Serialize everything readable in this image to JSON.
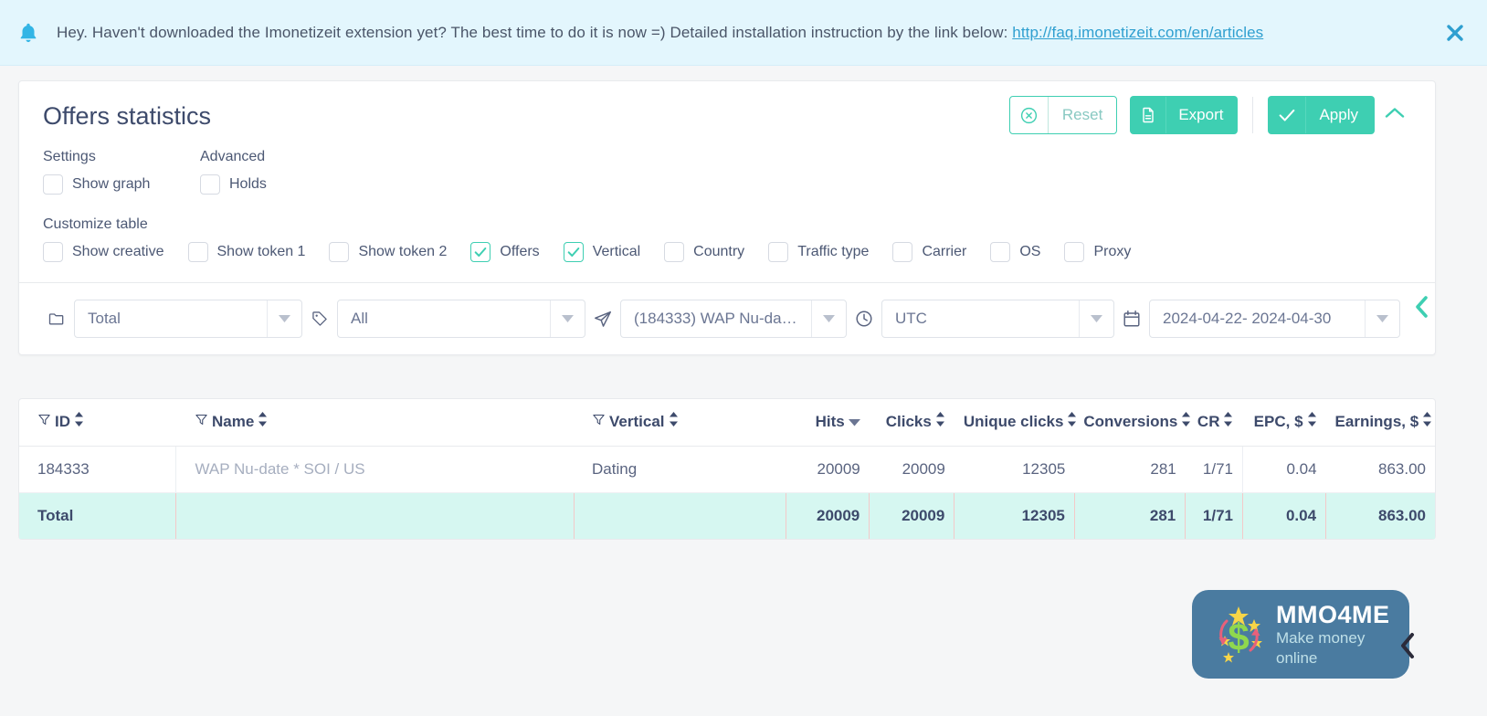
{
  "banner": {
    "icon": "bell-icon",
    "text_before": "Hey. Haven't downloaded the Imonetizeit extension yet? The best time to do it is now =) Detailed installation instruction by the link below: ",
    "link_text": "http://faq.imonetizeit.com/en/articles",
    "close_icon": "close-icon",
    "bg_color": "#e3f6fd"
  },
  "card": {
    "title": "Offers statistics",
    "actions": {
      "reset_label": "Reset",
      "reset_icon": "circle-x-icon",
      "export_label": "Export",
      "export_icon": "document-icon",
      "apply_label": "Apply",
      "apply_icon": "check-icon",
      "collapse_icon": "chevron-up-icon",
      "accent_color": "#3ecfb2"
    },
    "settings": {
      "group_label": "Settings",
      "items": [
        {
          "label": "Show graph",
          "checked": false
        }
      ]
    },
    "advanced": {
      "group_label": "Advanced",
      "items": [
        {
          "label": "Holds",
          "checked": false
        }
      ]
    },
    "customize": {
      "group_label": "Customize table",
      "items": [
        {
          "label": "Show creative",
          "checked": false
        },
        {
          "label": "Show token 1",
          "checked": false
        },
        {
          "label": "Show token 2",
          "checked": false
        },
        {
          "label": "Offers",
          "checked": true
        },
        {
          "label": "Vertical",
          "checked": true
        },
        {
          "label": "Country",
          "checked": false
        },
        {
          "label": "Traffic type",
          "checked": false
        },
        {
          "label": "Carrier",
          "checked": false
        },
        {
          "label": "OS",
          "checked": false
        },
        {
          "label": "Proxy",
          "checked": false
        }
      ]
    },
    "filters": [
      {
        "icon": "folder-icon",
        "value": "Total",
        "name": "group-select"
      },
      {
        "icon": "tag-icon",
        "value": "All",
        "name": "tag-select"
      },
      {
        "icon": "send-icon",
        "value": "(184333) WAP Nu-dat...",
        "name": "offer-select"
      },
      {
        "icon": "clock-icon",
        "value": "UTC",
        "name": "timezone-select"
      },
      {
        "icon": "calendar-icon",
        "value": "2024-04-22- 2024-04-30",
        "name": "date-range-select"
      }
    ]
  },
  "table": {
    "columns": [
      {
        "label": "ID",
        "filterable": true,
        "sortable": true,
        "sort": "none",
        "align": "left"
      },
      {
        "label": "Name",
        "filterable": true,
        "sortable": true,
        "sort": "none",
        "align": "left"
      },
      {
        "label": "Vertical",
        "filterable": true,
        "sortable": true,
        "sort": "none",
        "align": "left"
      },
      {
        "label": "Hits",
        "filterable": false,
        "sortable": true,
        "sort": "desc",
        "align": "right"
      },
      {
        "label": "Clicks",
        "filterable": false,
        "sortable": true,
        "sort": "none",
        "align": "right"
      },
      {
        "label": "Unique clicks",
        "filterable": false,
        "sortable": true,
        "sort": "none",
        "align": "right"
      },
      {
        "label": "Conversions",
        "filterable": false,
        "sortable": true,
        "sort": "none",
        "align": "right"
      },
      {
        "label": "CR",
        "filterable": false,
        "sortable": true,
        "sort": "none",
        "align": "right"
      },
      {
        "label": "EPC, $",
        "filterable": false,
        "sortable": true,
        "sort": "none",
        "align": "right"
      },
      {
        "label": "Earnings, $",
        "filterable": false,
        "sortable": true,
        "sort": "none",
        "align": "right"
      }
    ],
    "rows": [
      {
        "id": "184333",
        "name": "WAP Nu-date * SOI / US",
        "vertical": "Dating",
        "hits": "20009",
        "clicks": "20009",
        "unique_clicks": "12305",
        "conversions": "281",
        "cr": "1/71",
        "epc": "0.04",
        "earnings": "863.00"
      }
    ],
    "total": {
      "label": "Total",
      "name": "",
      "vertical": "",
      "hits": "20009",
      "clicks": "20009",
      "unique_clicks": "12305",
      "conversions": "281",
      "cr": "1/71",
      "epc": "0.04",
      "earnings": "863.00",
      "bg_color": "#d6f7f1"
    }
  },
  "edge": {
    "collapse_icon": "chevron-left-icon",
    "color": "#3ecfb2"
  },
  "watermark": {
    "title": "MMO4ME",
    "subtitle": "Make money online",
    "logo_icon": "dollar-stars-icon",
    "bg_color": "#4a7ba0",
    "chevron_icon": "chevron-left-icon"
  }
}
